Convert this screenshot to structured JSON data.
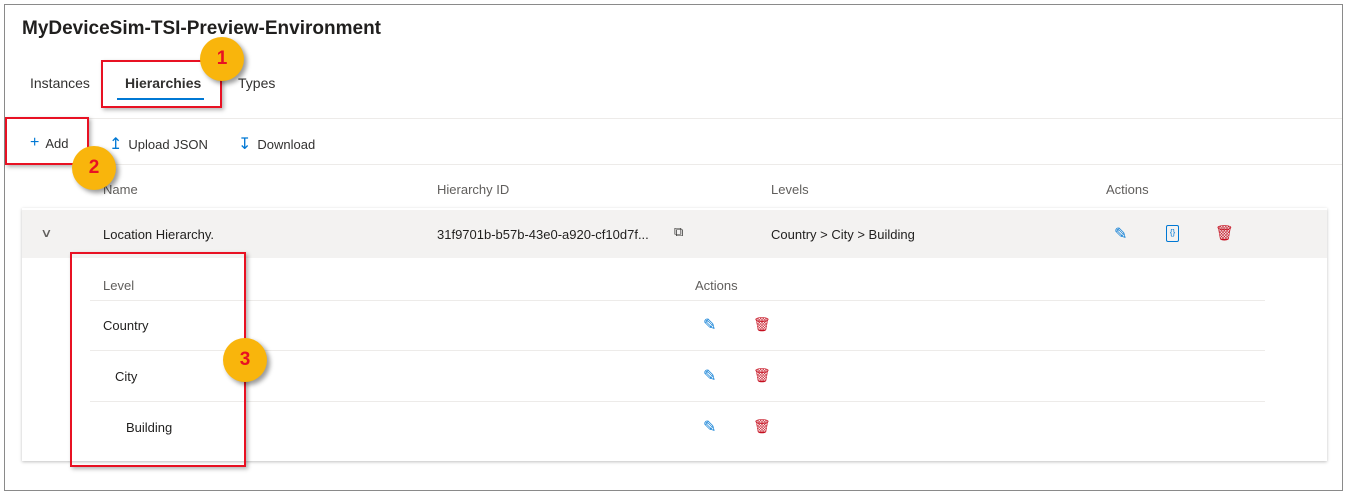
{
  "title": "MyDeviceSim-TSI-Preview-Environment",
  "tabs": [
    "Instances",
    "Hierarchies",
    "Types"
  ],
  "toolbar": {
    "add": "Add",
    "upload": "Upload JSON",
    "download": "Download"
  },
  "table": {
    "headers": [
      "Name",
      "Hierarchy ID",
      "Levels",
      "Actions"
    ],
    "row": {
      "name": "Location Hierarchy.",
      "id": "31f9701b-b57b-43e0-a920-cf10d7f...",
      "levels": "Country > City > Building"
    }
  },
  "subtable": {
    "headers": [
      "Level",
      "Actions"
    ],
    "levels": [
      "Country",
      "City",
      "Building"
    ]
  },
  "callouts": [
    "1",
    "2",
    "3"
  ],
  "colors": {
    "accent": "#0078d4",
    "delete": "#c50f1f",
    "callout": "#f9b50c",
    "highlight": "#e81123"
  }
}
